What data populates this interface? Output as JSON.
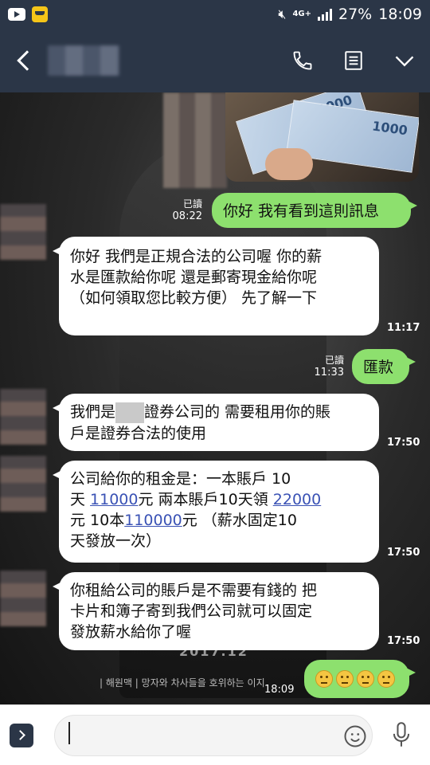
{
  "status_bar": {
    "battery": "27%",
    "time": "18:09",
    "network": "4G+"
  },
  "header": {
    "back_icon": "chevron-left-icon",
    "call_icon": "phone-icon",
    "menu_icon": "menu-icon",
    "more_icon": "chevron-down-icon"
  },
  "money_image": {
    "bill_value": "1000"
  },
  "messages": [
    {
      "id": "m1",
      "side": "out",
      "text": "你好 我有看到這則訊息",
      "read": "已讀",
      "time": "08:22"
    },
    {
      "id": "m2",
      "side": "in",
      "lines": [
        "你好 我們是正規合法的公司喔 你的薪",
        "水是匯款給你呢 還是郵寄現金給你呢",
        "（如何領取您比較方便） 先了解一下"
      ],
      "time": "11:17"
    },
    {
      "id": "m3",
      "side": "out",
      "text": "匯款",
      "read": "已讀",
      "time": "11:33"
    },
    {
      "id": "m4",
      "side": "in",
      "part1": "我們是",
      "part2": "證券公司的 需要租用你的賬",
      "line2": "戶是證券合法的使用",
      "time": "17:50"
    },
    {
      "id": "m5",
      "side": "in",
      "line1": "公司給你的租金是：一本賬戶 10",
      "line2_a": "天 ",
      "line2_link1": "11000",
      "line2_b": "元 兩本賬戶10天領 ",
      "line2_link2": "22000",
      "line3_a": "元 10本",
      "line3_link": "110000",
      "line3_b": "元 （薪水固定10",
      "line4": "天發放一次）",
      "time": "17:50"
    },
    {
      "id": "m6",
      "side": "in",
      "lines": [
        "你租給公司的賬戶是不需要有錢的 把",
        "卡片和簿子寄到我們公司就可以固定",
        "發放薪水給你了喔"
      ],
      "time": "17:50"
    },
    {
      "id": "m7",
      "side": "out",
      "emoji_count": 4,
      "time": "18:09"
    }
  ],
  "background": {
    "poster_date": "2017.12",
    "poster_credit": "| 해원맥 | 망자와 차사들을 호위하는 이지"
  },
  "input": {
    "placeholder": "",
    "expand_icon": "chevron-right-icon",
    "emoji_icon": "smile-icon",
    "mic_icon": "microphone-icon"
  }
}
